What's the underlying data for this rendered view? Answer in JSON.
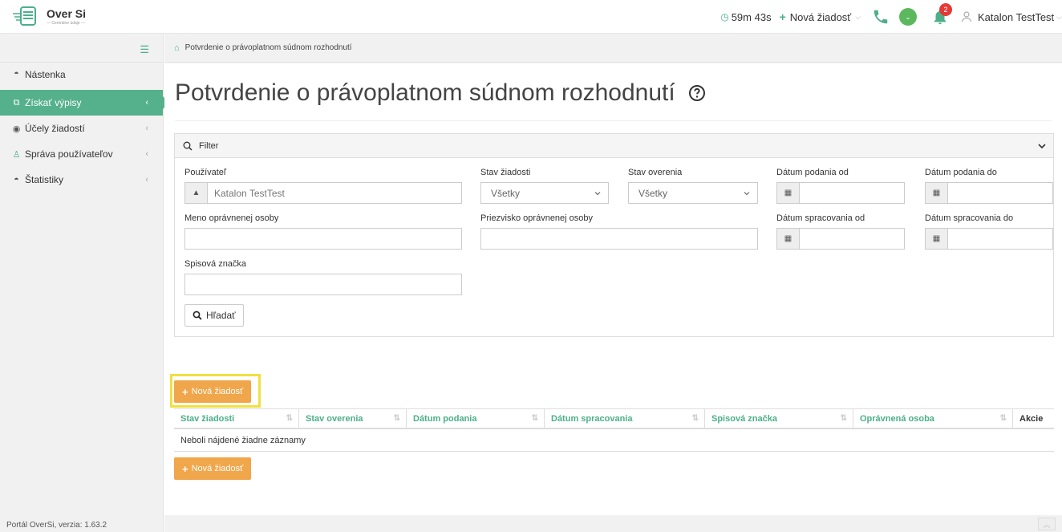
{
  "app": {
    "name": "Over Si",
    "tagline": "— Centrálne údaje —",
    "version": "Portál OverSi, verzia: 1.63.2"
  },
  "topbar": {
    "timer": "59m 43s",
    "new_request": "Nová žiadosť",
    "notifications_count": "2",
    "user_name": "Katalon TestTest",
    "accent_color": "#4caf8a"
  },
  "sidebar": {
    "items": [
      {
        "label": "Nástenka",
        "icon": "dashboard-icon"
      },
      {
        "label": "Získať výpisy",
        "icon": "copy-icon",
        "active": true
      },
      {
        "label": "Účely žiadostí",
        "icon": "target-icon"
      },
      {
        "label": "Správa používateľov",
        "icon": "users-icon"
      },
      {
        "label": "Štatistiky",
        "icon": "dashboard-icon"
      }
    ]
  },
  "breadcrumb": {
    "current": "Potvrdenie o právoplatnom súdnom rozhodnutí"
  },
  "page": {
    "title": "Potvrdenie o právoplatnom súdnom rozhodnutí"
  },
  "filter": {
    "title": "Filter",
    "user_label": "Používateľ",
    "user_value": "Katalon TestTest",
    "status_label": "Stav žiadosti",
    "status_value": "Všetky",
    "verification_label": "Stav overenia",
    "verification_value": "Všetky",
    "submitted_from_label": "Dátum podania od",
    "submitted_to_label": "Dátum podania do",
    "first_name_label": "Meno oprávnenej osoby",
    "last_name_label": "Priezvisko oprávnenej osoby",
    "processed_from_label": "Dátum spracovania od",
    "processed_to_label": "Dátum spracovania do",
    "file_mark_label": "Spisová značka",
    "search_button": "Hľadať"
  },
  "actions": {
    "new_request_button": "Nová žiadosť",
    "button_color": "#f0a64a"
  },
  "table": {
    "columns": [
      "Stav žiadosti",
      "Stav overenia",
      "Dátum podania",
      "Dátum spracovania",
      "Spisová značka",
      "Oprávnená osoba",
      "Akcie"
    ],
    "empty_message": "Neboli nájdené žiadne záznamy"
  }
}
